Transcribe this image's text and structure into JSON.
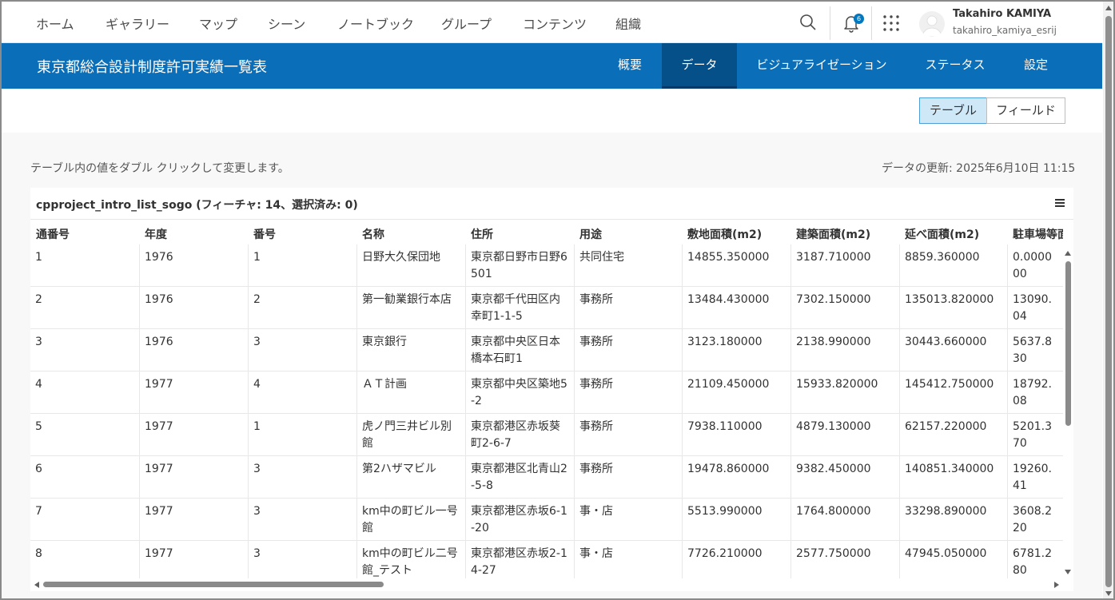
{
  "nav": {
    "items": [
      {
        "label": "ホーム"
      },
      {
        "label": "ギャラリー"
      },
      {
        "label": "マップ"
      },
      {
        "label": "シーン"
      },
      {
        "label": "ノートブック"
      },
      {
        "label": "グループ"
      },
      {
        "label": "コンテンツ"
      },
      {
        "label": "組織"
      }
    ],
    "notification_count": "6",
    "user_name": "Takahiro KAMIYA",
    "user_id": "takahiro_kamiya_esrij"
  },
  "titlebar": {
    "title": "東京都総合設計制度許可実績一覧表",
    "tabs": [
      {
        "label": "概要"
      },
      {
        "label": "データ"
      },
      {
        "label": "ビジュアライゼーション"
      },
      {
        "label": "ステータス"
      },
      {
        "label": "設定"
      }
    ],
    "active_tab": "データ",
    "color": "#0a6fb8"
  },
  "view_toggle": {
    "table_label": "テーブル",
    "fields_label": "フィールド"
  },
  "hint": "テーブル内の値をダブル クリックして変更します。",
  "updated": "データの更新: 2025年6月10日 11:15",
  "table": {
    "title": "cpproject_intro_list_sogo (フィーチャ: 14、選択済み: 0)",
    "columns": [
      "通番号",
      "年度",
      "番号",
      "名称",
      "住所",
      "用途",
      "敷地面積(m2)",
      "建築面積(m2)",
      "延べ面積(m2)",
      "駐車場等面積"
    ],
    "rows": [
      [
        "1",
        "1976",
        "1",
        "日野大久保団地",
        "東京都日野市日野6501",
        "共同住宅",
        "14855.350000",
        "3187.710000",
        "8859.360000",
        "0.000000"
      ],
      [
        "2",
        "1976",
        "2",
        "第一勧業銀行本店",
        "東京都千代田区内幸町1-1-5",
        "事務所",
        "13484.430000",
        "7302.150000",
        "135013.820000",
        "13090.04"
      ],
      [
        "3",
        "1976",
        "3",
        "東京銀行",
        "東京都中央区日本橋本石町1",
        "事務所",
        "3123.180000",
        "2138.990000",
        "30443.660000",
        "5637.830"
      ],
      [
        "4",
        "1977",
        "4",
        "ＡＴ計画",
        "東京都中央区築地5-2",
        "事務所",
        "21109.450000",
        "15933.820000",
        "145412.750000",
        "18792.08"
      ],
      [
        "5",
        "1977",
        "1",
        "虎ノ門三井ビル別館",
        "東京都港区赤坂葵町2-6-7",
        "事務所",
        "7938.110000",
        "4879.130000",
        "62157.220000",
        "5201.370"
      ],
      [
        "6",
        "1977",
        "3",
        "第2ハザマビル",
        "東京都港区北青山2-5-8",
        "事務所",
        "19478.860000",
        "9382.450000",
        "140851.340000",
        "19260.41"
      ],
      [
        "7",
        "1977",
        "3",
        "km中の町ビル一号館",
        "東京都港区赤坂6-1-20",
        "事・店",
        "5513.990000",
        "1764.800000",
        "33298.890000",
        "3608.220"
      ],
      [
        "8",
        "1977",
        "3",
        "km中の町ビル二号館_テスト",
        "東京都港区赤坂2-14-27",
        "事・店",
        "7726.210000",
        "2577.750000",
        "47945.050000",
        "6781.280"
      ]
    ]
  }
}
